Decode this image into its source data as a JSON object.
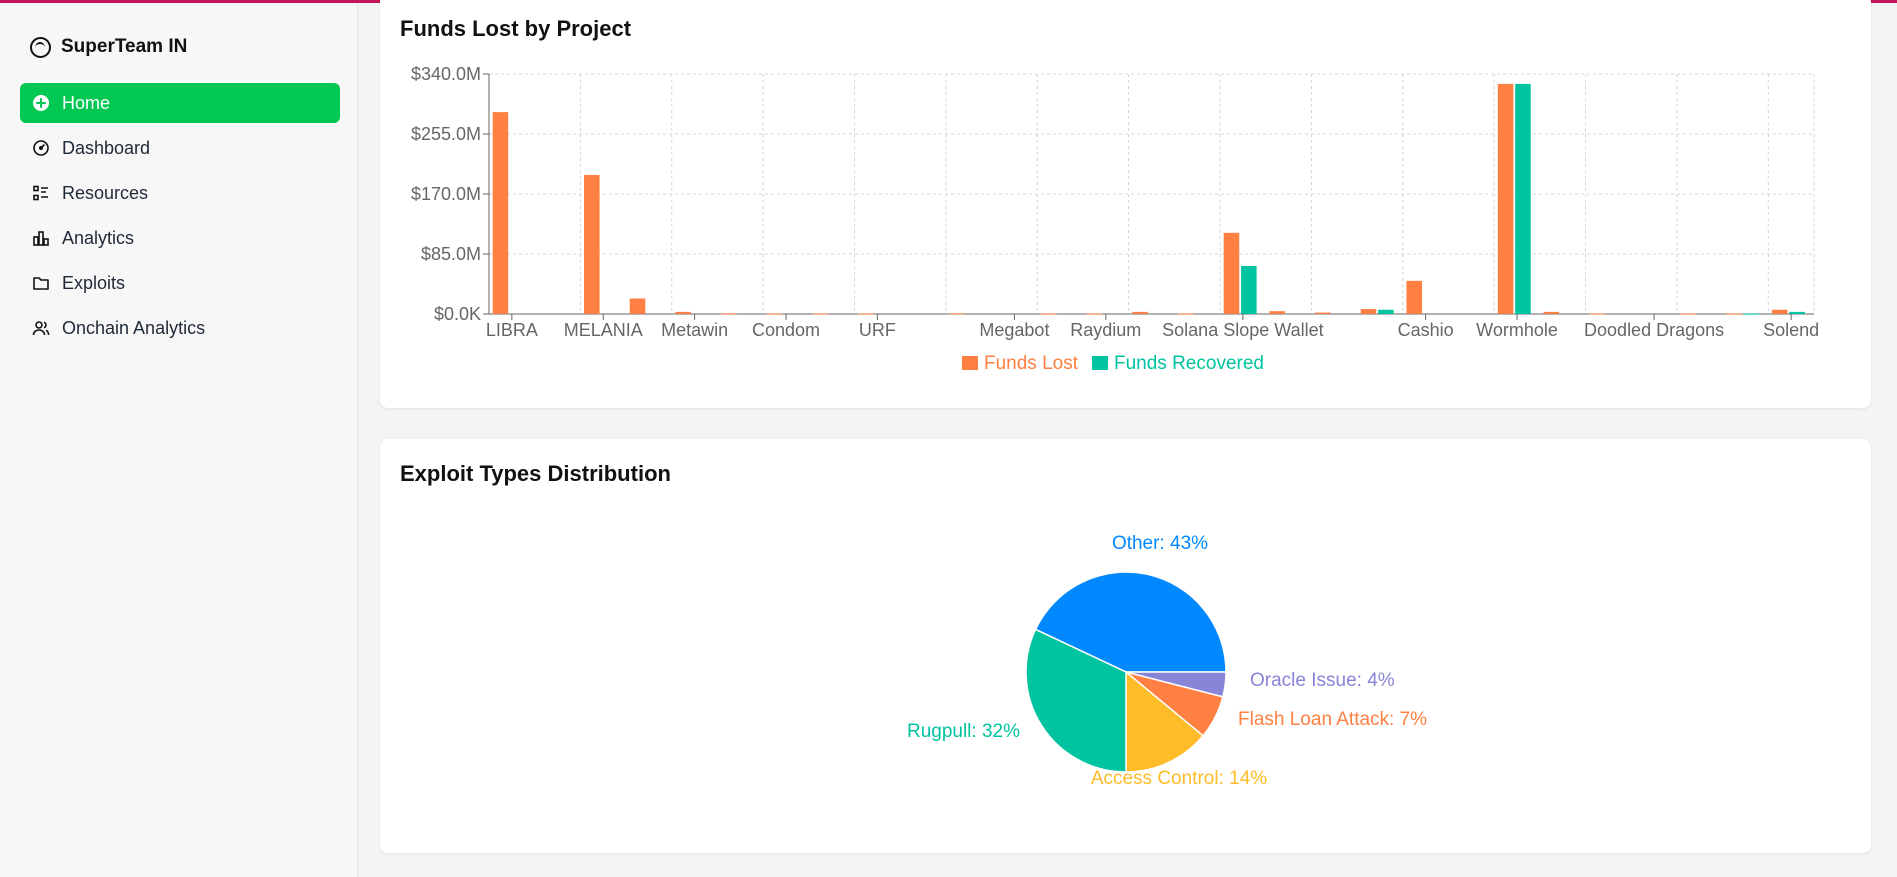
{
  "app": {
    "brand": "SuperTeam IN"
  },
  "sidebar": {
    "items": [
      {
        "label": "Home",
        "icon": "plus-circle-icon",
        "active": true
      },
      {
        "label": "Dashboard",
        "icon": "gauge-icon"
      },
      {
        "label": "Resources",
        "icon": "list-icon"
      },
      {
        "label": "Analytics",
        "icon": "bar-chart-icon"
      },
      {
        "label": "Exploits",
        "icon": "folder-icon"
      },
      {
        "label": "Onchain Analytics",
        "icon": "users-icon"
      }
    ]
  },
  "colors": {
    "active_nav": "#00c853",
    "funds_lost": "#ff8042",
    "funds_recovered": "#00c49f",
    "top_accent": "#c2185b"
  },
  "cards": {
    "funds_title": "Funds Lost by Project",
    "exploit_title": "Exploit Types Distribution"
  },
  "chart_data": [
    {
      "type": "bar",
      "title": "Funds Lost by Project",
      "y_ticks": [
        "$0.0K",
        "$85.0M",
        "$170.0M",
        "$255.0M",
        "$340.0M"
      ],
      "ylim": [
        0,
        340
      ],
      "y_unit": "M USD",
      "x_tick_labels": [
        "LIBRA",
        "MELANIA",
        "Metawin",
        "Condom",
        "URF",
        "Megabot",
        "Raydium",
        "Solana Slope Wallet",
        "Cashio",
        "Wormhole",
        "Doodled Dragons",
        "Solend"
      ],
      "grid": true,
      "legend_position": "bottom",
      "series": [
        {
          "name": "Funds Lost",
          "color": "#ff8042",
          "values": [
            286,
            0,
            197,
            22,
            3,
            1,
            0.5,
            0.5,
            0.5,
            0,
            1,
            0,
            0.5,
            0.5,
            3,
            0.5,
            115,
            4,
            2,
            7,
            47,
            0,
            326,
            3,
            0.5,
            0,
            0.5,
            0.5,
            6
          ]
        },
        {
          "name": "Funds Recovered",
          "color": "#00c49f",
          "values": [
            0,
            0,
            0,
            0,
            0,
            0,
            0,
            0,
            0,
            0,
            0,
            0,
            0,
            0,
            0,
            0,
            68,
            0,
            0,
            6,
            0,
            0,
            326,
            0,
            0,
            0,
            0,
            0.5,
            3
          ]
        }
      ]
    },
    {
      "type": "pie",
      "title": "Exploit Types Distribution",
      "slices": [
        {
          "label": "Other: 43%",
          "value": 43,
          "color": "#0088fe"
        },
        {
          "label": "Oracle Issue: 4%",
          "value": 4,
          "color": "#8884d8"
        },
        {
          "label": "Flash Loan Attack: 7%",
          "value": 7,
          "color": "#ff8042"
        },
        {
          "label": "Access Control: 14%",
          "value": 14,
          "color": "#ffbb28"
        },
        {
          "label": "Rugpull: 32%",
          "value": 32,
          "color": "#00c49f"
        }
      ]
    }
  ]
}
